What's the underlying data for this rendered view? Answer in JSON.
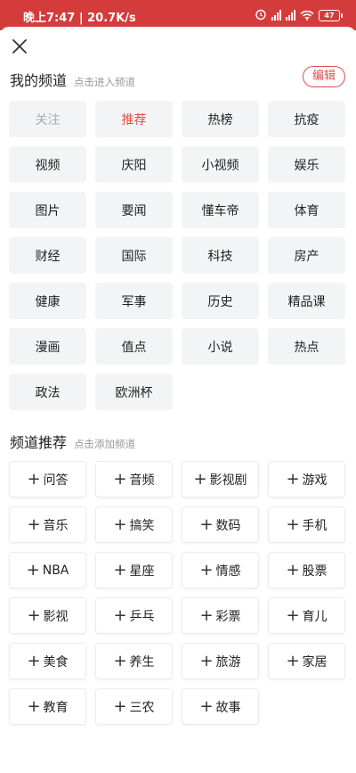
{
  "status_bar": {
    "time_speed": "晚上7:47 | 20.7K/s",
    "battery": "47"
  },
  "my_channels": {
    "title": "我的频道",
    "hint": "点击进入频道",
    "edit_label": "编辑",
    "items": [
      {
        "label": "关注",
        "state": "fixed"
      },
      {
        "label": "推荐",
        "state": "active"
      },
      {
        "label": "热榜",
        "state": "normal"
      },
      {
        "label": "抗疫",
        "state": "normal"
      },
      {
        "label": "视频",
        "state": "normal"
      },
      {
        "label": "庆阳",
        "state": "normal"
      },
      {
        "label": "小视频",
        "state": "normal"
      },
      {
        "label": "娱乐",
        "state": "normal"
      },
      {
        "label": "图片",
        "state": "normal"
      },
      {
        "label": "要闻",
        "state": "normal"
      },
      {
        "label": "懂车帝",
        "state": "normal"
      },
      {
        "label": "体育",
        "state": "normal"
      },
      {
        "label": "财经",
        "state": "normal"
      },
      {
        "label": "国际",
        "state": "normal"
      },
      {
        "label": "科技",
        "state": "normal"
      },
      {
        "label": "房产",
        "state": "normal"
      },
      {
        "label": "健康",
        "state": "normal"
      },
      {
        "label": "军事",
        "state": "normal"
      },
      {
        "label": "历史",
        "state": "normal"
      },
      {
        "label": "精品课",
        "state": "normal"
      },
      {
        "label": "漫画",
        "state": "normal"
      },
      {
        "label": "值点",
        "state": "normal"
      },
      {
        "label": "小说",
        "state": "normal"
      },
      {
        "label": "热点",
        "state": "normal"
      },
      {
        "label": "政法",
        "state": "normal"
      },
      {
        "label": "欧洲杯",
        "state": "normal"
      }
    ]
  },
  "recommended_channels": {
    "title": "频道推荐",
    "hint": "点击添加频道",
    "items": [
      {
        "label": "问答"
      },
      {
        "label": "音频"
      },
      {
        "label": "影视剧"
      },
      {
        "label": "游戏"
      },
      {
        "label": "音乐"
      },
      {
        "label": "搞笑"
      },
      {
        "label": "数码"
      },
      {
        "label": "手机"
      },
      {
        "label": "NBA"
      },
      {
        "label": "星座"
      },
      {
        "label": "情感"
      },
      {
        "label": "股票"
      },
      {
        "label": "影视"
      },
      {
        "label": "乒乓"
      },
      {
        "label": "彩票"
      },
      {
        "label": "育儿"
      },
      {
        "label": "美食"
      },
      {
        "label": "养生"
      },
      {
        "label": "旅游"
      },
      {
        "label": "家居"
      },
      {
        "label": "教育"
      },
      {
        "label": "三农"
      },
      {
        "label": "故事"
      }
    ]
  },
  "colors": {
    "accent": "#e24b4b",
    "status_bar": "#d43c3c",
    "chip_bg": "#f3f4f6"
  }
}
